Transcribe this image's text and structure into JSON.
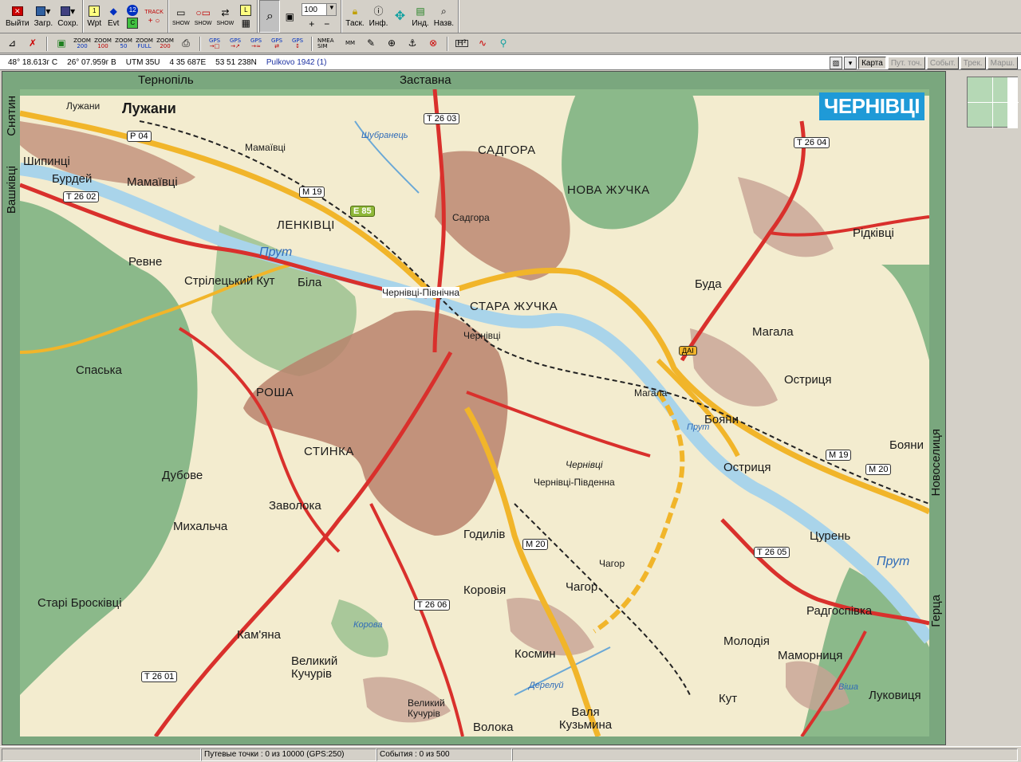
{
  "toolbar": {
    "exit_label": "Выйти",
    "load_label": "Загр.",
    "save_label": "Сохр.",
    "wpt_label": "Wpt",
    "evt_label": "Evt",
    "track_label": "TRACK",
    "show_label": "SHOW",
    "zoom_value": "100",
    "task_label": "Таск.",
    "info_label": "Инф.",
    "ind_label": "Инд.",
    "name_label": "Назв."
  },
  "toolbar2": {
    "zoom_buttons": [
      {
        "top": "ZOOM",
        "bottom": "200"
      },
      {
        "top": "ZOOM",
        "bottom": "100"
      },
      {
        "top": "ZOOM",
        "bottom": "50"
      },
      {
        "top": "ZOOM",
        "bottom": "FULL"
      },
      {
        "top": "ZOOM",
        "bottom": "200"
      }
    ],
    "gps_buttons": [
      "GPS",
      "GPS",
      "GPS",
      "GPS",
      "GPS"
    ],
    "nmea_label": "NMEA SIM",
    "mm_label": "MM"
  },
  "coordinates": {
    "lat": "48° 18.613г С",
    "lon": "26° 07.959г В",
    "utm_zone": "UTM  35U",
    "easting": "4 35 687E",
    "northing": "53 51 238N",
    "datum": "Pulkovo 1942 (1)"
  },
  "map_tabs": {
    "map": "Карта",
    "waypoints": "Пут. точ.",
    "events": "Событ.",
    "tracks": "Трек.",
    "routes": "Марш."
  },
  "map": {
    "city_title": "ЧЕРНІВЦІ",
    "edges": {
      "top_left": "Тернопіль",
      "top_mid": "Заставна",
      "left_top": "Снятин",
      "left_mid": "Вашківці",
      "right_mid": "Новоселиця",
      "right_bottom": "Герца"
    },
    "places": {
      "luzhany_big": "Лужани",
      "luzhany_small": "Лужани",
      "mamaivtsi": "Мамаївці",
      "mamaivtsi2": "Мамаївці",
      "shypyntsi": "Шипинці",
      "burdei": "Бурдей",
      "sadgora_caps": "САДГОРА",
      "sadgora": "Садгора",
      "nova_zhuchka": "НОВА ЖУЧКА",
      "lenkivtsi": "ЛЕНКІВЦІ",
      "revne": "Ревне",
      "striletskyi": "Стрілецький Кут",
      "bila": "Біла",
      "chernivtsi_pivn": "Чернівці-Північна",
      "stara_zhuchka": "СТАРА ЖУЧКА",
      "chernivtsi_small": "Чернівці",
      "ridkivtsi": "Рідківці",
      "buda": "Буда",
      "mahala": "Магала",
      "mahala2": "Магала",
      "ostrytsia": "Остриця",
      "ostrytsia2": "Остриця",
      "spaska": "Спаська",
      "rosha": "РОША",
      "stynka": "СТИНКА",
      "dubove": "Дубове",
      "zavoloka": "Заволока",
      "mykhalcha": "Михальча",
      "boiany": "Бояни",
      "chernivtsi_airport": "Чернівці",
      "chernivtsi_pivd": "Чернівці-Південна",
      "godyliv": "Годилів",
      "tsuren": "Цурень",
      "chahor": "Чагор",
      "chahor2": "Чагор",
      "korovia": "Коровія",
      "stari_broskivtsi": "Старі Бросківці",
      "kamiana": "Кам'яна",
      "radhospivka": "Радгоспівка",
      "moldiia": "Молодія",
      "mamornytsia": "Маморниця",
      "velykyi_kuchuriv": "Великий Кучурів",
      "kosmyn": "Космин",
      "kut": "Кут",
      "lukovytsia": "Луковиця",
      "velykyi_kuchuriv2": "Великий Кучурів",
      "volka": "Волока",
      "valia_kuzmyna": "Валя Кузьмина"
    },
    "rivers": {
      "prut1": "Прут",
      "prut2": "Прут",
      "prut3": "Прут",
      "shubranets": "Шубранець",
      "derelui": "Дерелуй",
      "korova": "Корова",
      "visha": "Віша"
    },
    "roads": {
      "r04": "Р 04",
      "m19": "М 19",
      "e85": "Е 85",
      "t2602": "Т 26 02",
      "t2603": "Т 26 03",
      "t2604": "Т 26 04",
      "m19b": "М 19",
      "m20": "М 20",
      "m20b": "М 20",
      "t2605": "Т 26 05",
      "t2606": "Т 26 06",
      "t2601": "Т 26 01",
      "dai": "ДАІ"
    }
  },
  "statusbar": {
    "waypoints": "Путевые точки : 0 из 10000  (GPS:250)",
    "events": "События : 0 из 500"
  },
  "colors": {
    "forest": "#7aa77e",
    "land": "#f3eccf",
    "urban": "#b9826c",
    "water": "#a9d4ea",
    "road_red": "#d9302c",
    "road_yellow": "#f1b52a",
    "badge": "#1f9ad7"
  }
}
